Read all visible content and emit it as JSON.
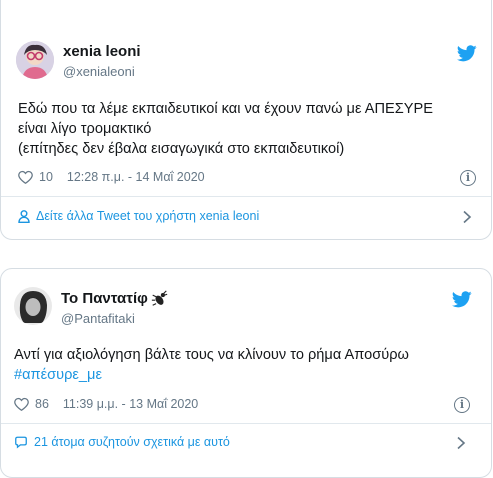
{
  "tweet1": {
    "name": "xenia leoni",
    "handle": "@xenialeoni",
    "lines": [
      "Εδώ που τα λέμε εκπαιδευτικοί και να έχουν πανώ με ΑΠΕΣΥΡΕ",
      "είναι λίγο τρομακτικό",
      "(επίτηδες δεν έβαλα εισαγωγικά στο εκπαιδευτικοί)"
    ],
    "likes": "10",
    "timestamp": "12:28 π.μ. - 14 Μαΐ 2020",
    "footer_link": "Δείτε άλλα Tweet του χρήστη xenia leoni"
  },
  "tweet2": {
    "name": "Το Παντατίφ",
    "handle": "@Pantafitaki",
    "line1": "Αντί για αξιολόγηση βάλτε τους να κλίνουν το ρήμα Αποσύρω",
    "hashtag": "#απέσυρε_με",
    "likes": "86",
    "timestamp": "11:39 μ.μ. - 13 Μαΐ 2020",
    "footer_link": "21 άτομα συζητούν σχετικά με αυτό"
  },
  "colors": {
    "accent": "#1b95e0",
    "twitter_blue": "#1da1f2",
    "muted": "#657786",
    "border": "#d6dde3"
  },
  "icons": [
    "twitter-bird-icon",
    "heart-icon",
    "info-icon",
    "user-icon",
    "chevron-right-icon",
    "comment-icon",
    "bug-emoji-icon"
  ]
}
